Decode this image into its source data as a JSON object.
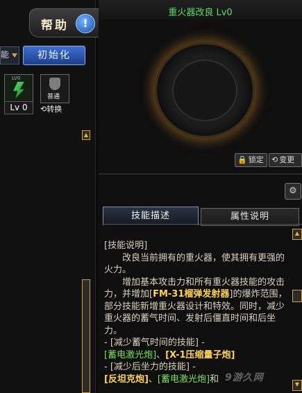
{
  "header": {
    "help_label": "帮助",
    "help_icon": "!",
    "title": "重火器改良 Lv0"
  },
  "left": {
    "dropdown_label": "能",
    "init_button": "初始化",
    "skill_slot_level_text": "LV0",
    "slot_level": "Lv 0",
    "swap_slot_text": "普通",
    "swap_label": "转换",
    "swap_icon": "⟲"
  },
  "preview": {
    "lock_label": "锁定",
    "change_label": "变更",
    "lock_icon": "🔒",
    "change_icon": "⟲"
  },
  "tabs": [
    "技能描述",
    "属性说明"
  ],
  "description": {
    "heading": "[技能说明]",
    "p1": "改良当前拥有的重火器，使其拥有更强的火力。",
    "p2_before": "增加基本攻击力和所有重火器技能的攻击力，并增加[",
    "p2_highlight": "FM-31榴弹发射器",
    "p2_after": "]的爆炸范围，部分技能新增重火器设计和特效。同时，减少重火器的蓄气时间、发射后僵直时间和后坐力。",
    "group1_title": "- [减少蓄气时间的技能] -",
    "group1_a": "[蓄电激光炮]",
    "group1_sep": "、",
    "group1_b": "[X-1压缩量子炮]",
    "group2_title": "- [减少后坐力的技能] -",
    "group2_a": "[反坦克炮]",
    "group2_sep": "、",
    "group2_b": "[蓄电激光炮]",
    "group2_tail": "和"
  },
  "watermark": "9游久网"
}
